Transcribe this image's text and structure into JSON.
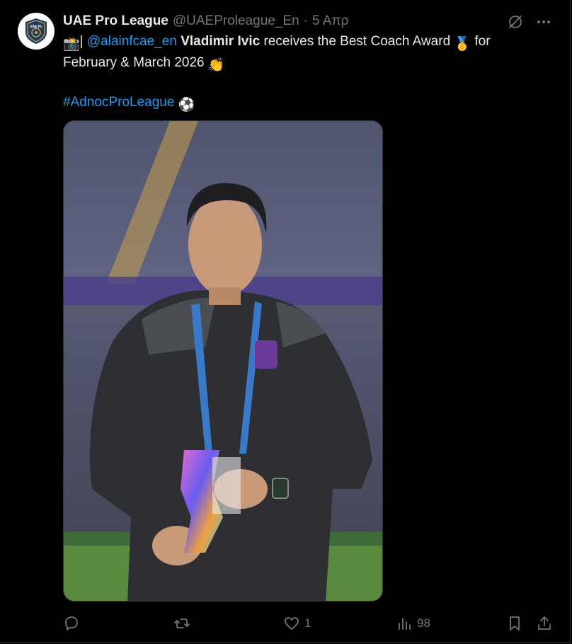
{
  "account": {
    "display_name": "UAE Pro League",
    "handle": "@UAEProleague_En",
    "separator": "·",
    "time": "5 Απρ",
    "avatar_text": "UAE PL"
  },
  "tweet": {
    "emoji_camera": "📸",
    "pipe": "|",
    "mention": "@alainfcae_en",
    "bold_name": "Vladimir Ivic",
    "text_1": "receives the Best Coach Award",
    "emoji_medal": "🥇",
    "text_2": "for",
    "line_2": "February & March 2026",
    "emoji_clap": "👏",
    "hashtag": "#AdnocProLeague",
    "emoji_ball": "⚽"
  },
  "actions": {
    "replies": "",
    "reposts": "",
    "likes": "1",
    "views": "98"
  },
  "colors": {
    "background": "#000000",
    "text": "#e7e9ea",
    "muted": "#71767b",
    "link": "#1d9bf0"
  },
  "icons": [
    "grok-icon",
    "more-icon",
    "reply-icon",
    "repost-icon",
    "like-icon",
    "views-icon",
    "bookmark-icon",
    "share-icon"
  ]
}
